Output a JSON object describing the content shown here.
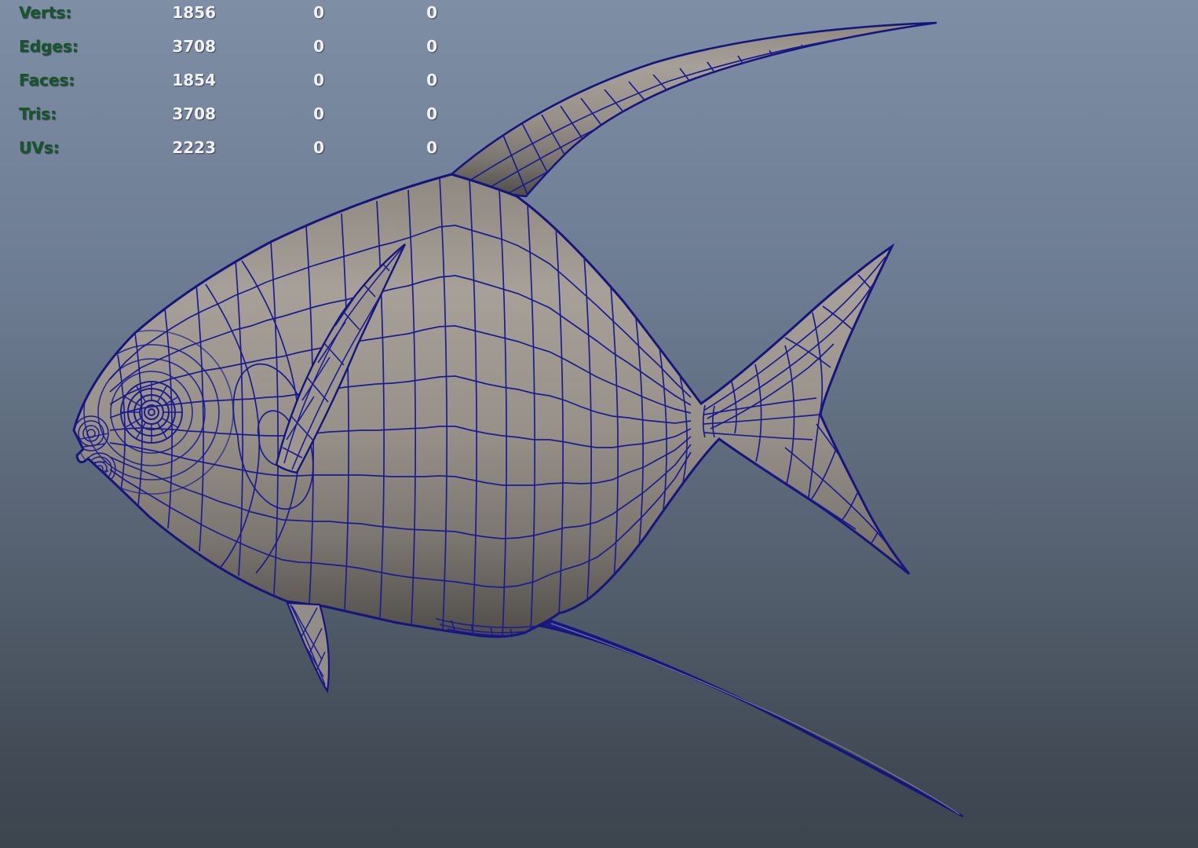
{
  "viewport": {
    "name": "perspective-3d-viewport",
    "background_top": "#7e8ea4",
    "background_bottom": "#3c444e",
    "wireframe_color": "#1c1c90",
    "silhouette_color": "#15157e",
    "model": "fish-wireframe-model"
  },
  "hud": {
    "label_color": "#17552a",
    "value_color": "#f2f2f2",
    "rows": [
      {
        "label": "Verts:",
        "values": [
          "1856",
          "0",
          "0"
        ]
      },
      {
        "label": "Edges:",
        "values": [
          "3708",
          "0",
          "0"
        ]
      },
      {
        "label": "Faces:",
        "values": [
          "1854",
          "0",
          "0"
        ]
      },
      {
        "label": "Tris:",
        "values": [
          "3708",
          "0",
          "0"
        ]
      },
      {
        "label": "UVs:",
        "values": [
          "2223",
          "0",
          "0"
        ]
      }
    ]
  }
}
